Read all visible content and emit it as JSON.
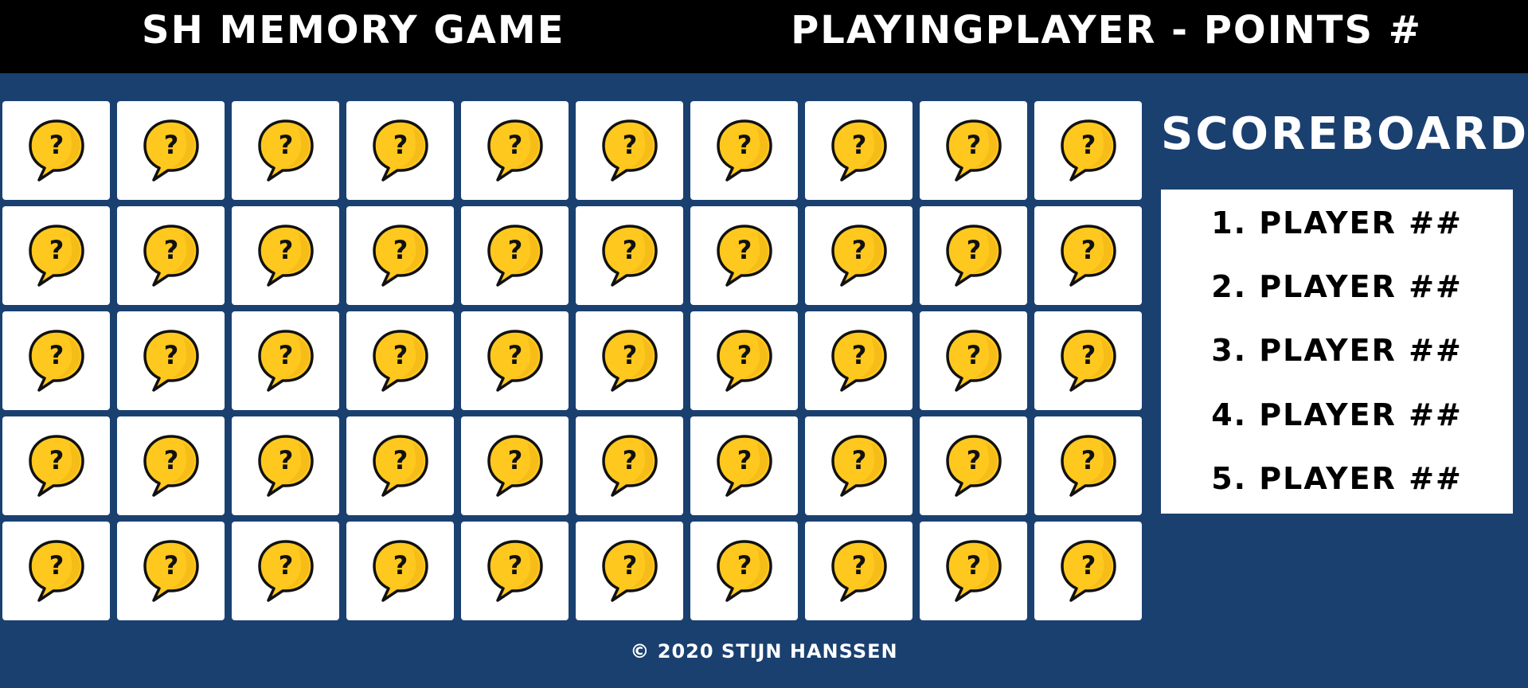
{
  "header": {
    "title": "SH MEMORY GAME",
    "status": "PLAYINGPLAYER - POINTS #"
  },
  "board": {
    "rows": 5,
    "columns": 10,
    "card_icon": "question-bubble-icon",
    "card_glyph": "?"
  },
  "scoreboard": {
    "title": "SCOREBOARD",
    "entries": [
      "1. PLAYER ##",
      "2. PLAYER ##",
      "3. PLAYER ##",
      "4. PLAYER ##",
      "5. PLAYER ##"
    ]
  },
  "footer": {
    "text": "© 2020 STIJN HANSSEN"
  },
  "colors": {
    "background": "#1a4070",
    "header": "#000000",
    "card": "#ffffff",
    "icon_fill": "#ffc81e",
    "icon_stroke": "#111111"
  }
}
